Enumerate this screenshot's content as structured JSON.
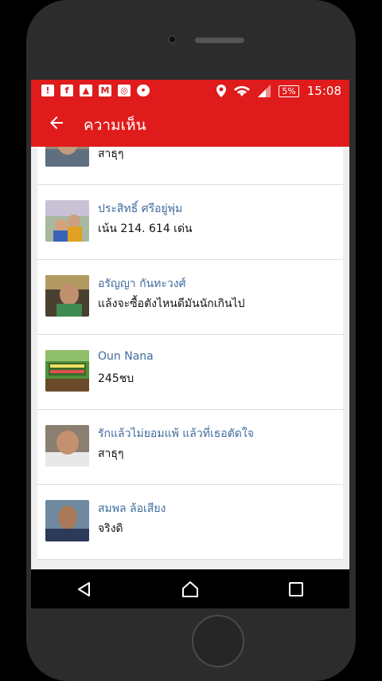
{
  "status_bar": {
    "left_icons": [
      "alert-icon",
      "facebook-icon",
      "image-icon",
      "gmail-icon",
      "instagram-icon",
      "line-icon"
    ],
    "battery": "5%",
    "time": "15:08"
  },
  "toolbar": {
    "title": "ความเห็น"
  },
  "comments": [
    {
      "name": "",
      "text": "สาธุๆ"
    },
    {
      "name": "ประสิทธิ์ ศรีอยู่พุ่ม",
      "text": "เน้น 214. 614 เด่น"
    },
    {
      "name": "อรัญญา กันทะวงศ์",
      "text": "แล้งจะซื้อตังไหนดีมันนักเกินไป"
    },
    {
      "name": "Oun Nana",
      "text": "245ชบ"
    },
    {
      "name": "รักแล้วไม่ยอมแพ้ แล้วที่เธอตัดใจ",
      "text": "สาธุๆ"
    },
    {
      "name": "สมพล ล้อเสียง",
      "text": "จริงดิ"
    }
  ],
  "colors": {
    "accent": "#e01b1b",
    "name_link": "#3f6c9e"
  }
}
